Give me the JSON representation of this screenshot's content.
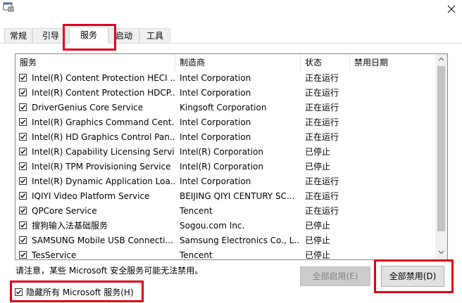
{
  "tabs": [
    {
      "label": "常规",
      "active": false
    },
    {
      "label": "引导",
      "active": false
    },
    {
      "label": "服务",
      "active": true
    },
    {
      "label": "启动",
      "active": false
    },
    {
      "label": "工具",
      "active": false
    }
  ],
  "table": {
    "columns": [
      "服务",
      "制造商",
      "状态",
      "禁用日期"
    ],
    "rows": [
      {
        "checked": true,
        "service": "Intel(R) Content Protection HECI ...",
        "vendor": "Intel Corporation",
        "status": "正在运行",
        "date": ""
      },
      {
        "checked": true,
        "service": "Intel(R) Content Protection HDCP...",
        "vendor": "Intel Corporation",
        "status": "正在运行",
        "date": ""
      },
      {
        "checked": true,
        "service": "DriverGenius Core Service",
        "vendor": "Kingsoft Corporation",
        "status": "正在运行",
        "date": ""
      },
      {
        "checked": true,
        "service": "Intel(R) Graphics Command Cent...",
        "vendor": "Intel Corporation",
        "status": "正在运行",
        "date": ""
      },
      {
        "checked": true,
        "service": "Intel(R) HD Graphics Control Pan...",
        "vendor": "Intel Corporation",
        "status": "正在运行",
        "date": ""
      },
      {
        "checked": true,
        "service": "Intel(R) Capability Licensing Servi...",
        "vendor": "Intel(R) Corporation",
        "status": "已停止",
        "date": ""
      },
      {
        "checked": true,
        "service": "Intel(R) TPM Provisioning Service",
        "vendor": "Intel(R) Corporation",
        "status": "已停止",
        "date": ""
      },
      {
        "checked": true,
        "service": "Intel(R) Dynamic Application Loa...",
        "vendor": "Intel Corporation",
        "status": "正在运行",
        "date": ""
      },
      {
        "checked": true,
        "service": "IQIYI Video Platform Service",
        "vendor": "BEIJING QIYI CENTURY SC...",
        "status": "正在运行",
        "date": ""
      },
      {
        "checked": true,
        "service": "QPCore Service",
        "vendor": "Tencent",
        "status": "正在运行",
        "date": ""
      },
      {
        "checked": true,
        "service": "搜狗输入法基础服务",
        "vendor": "Sogou.com Inc.",
        "status": "已停止",
        "date": ""
      },
      {
        "checked": true,
        "service": "SAMSUNG Mobile USB Connecti...",
        "vendor": "Samsung Electronics Co., L...",
        "status": "已停止",
        "date": ""
      },
      {
        "checked": true,
        "service": "TesService",
        "vendor": "Tencent",
        "status": "已停止",
        "date": ""
      }
    ]
  },
  "footer": {
    "notice": "请注意，某些 Microsoft 安全服务可能无法禁用。",
    "enable_all_label": "全部启用(E)",
    "disable_all_label": "全部禁用(D)",
    "hide_ms_label": "隐藏所有 Microsoft 服务(H)",
    "hide_ms_checked": true
  },
  "icons": {
    "app": "msconfig-icon",
    "close": "close-icon",
    "scroll_up": "chevron-up-icon",
    "scroll_down": "chevron-down-icon",
    "checkbox": "checkmark-icon"
  },
  "colors": {
    "highlight": "#e0001b",
    "disabled_button": "#cccccc",
    "button": "#e1e1e1"
  }
}
